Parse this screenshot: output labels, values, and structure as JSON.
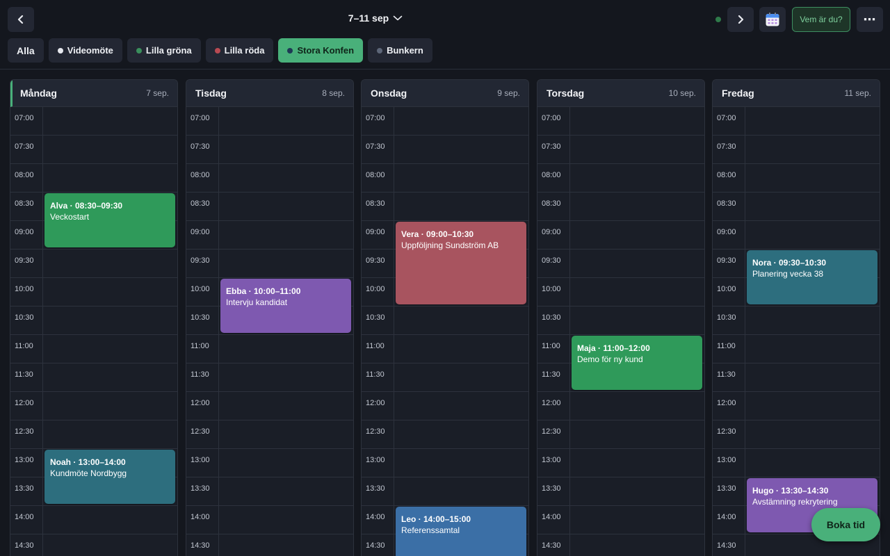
{
  "header": {
    "week_label": "7–11 sep",
    "who_button": "Vem är du?",
    "prev_icon": "chevron-left-icon",
    "next_icon": "chevron-right-icon",
    "more_label": "⋯"
  },
  "filters": [
    {
      "label": "Alla",
      "dot": null,
      "active": false
    },
    {
      "label": "Videomöte",
      "dot": "#e6e8ee",
      "active": false
    },
    {
      "label": "Lilla gröna",
      "dot": "#3a8f5c",
      "active": false
    },
    {
      "label": "Lilla röda",
      "dot": "#b84a52",
      "active": false
    },
    {
      "label": "Stora Konfen",
      "dot": "#1e3a55",
      "active": true
    },
    {
      "label": "Bunkern",
      "dot": "#5d6678",
      "active": false
    }
  ],
  "times": [
    "07:00",
    "07:30",
    "08:00",
    "08:30",
    "09:00",
    "09:30",
    "10:00",
    "10:30",
    "11:00",
    "11:30",
    "12:00",
    "12:30",
    "13:00",
    "13:30",
    "14:00",
    "14:30"
  ],
  "days": [
    {
      "name": "Måndag",
      "date": "7 sep.",
      "today": true,
      "events": [
        {
          "title": "Alva · 08:30–09:30",
          "desc": "Veckostart",
          "start": "08:30",
          "end": "09:30",
          "color": "#2f9a5a"
        },
        {
          "title": "Noah · 13:00–14:00",
          "desc": "Kundmöte Nordbygg",
          "start": "13:00",
          "end": "14:00",
          "color": "#2d6e7e"
        }
      ]
    },
    {
      "name": "Tisdag",
      "date": "8 sep.",
      "today": false,
      "events": [
        {
          "title": "Ebba · 10:00–11:00",
          "desc": "Intervju kandidat",
          "start": "10:00",
          "end": "11:00",
          "color": "#7e59b0"
        }
      ]
    },
    {
      "name": "Onsdag",
      "date": "9 sep.",
      "today": false,
      "events": [
        {
          "title": "Vera · 09:00–10:30",
          "desc": "Uppföljning Sundström AB",
          "start": "09:00",
          "end": "10:30",
          "color": "#a8545f"
        },
        {
          "title": "Leo · 14:00–15:00",
          "desc": "Referenssamtal",
          "start": "14:00",
          "end": "15:00",
          "color": "#3b6fa6"
        }
      ]
    },
    {
      "name": "Torsdag",
      "date": "10 sep.",
      "today": false,
      "events": [
        {
          "title": "Maja · 11:00–12:00",
          "desc": "Demo för ny kund",
          "start": "11:00",
          "end": "12:00",
          "color": "#2f9a5a"
        }
      ]
    },
    {
      "name": "Fredag",
      "date": "11 sep.",
      "today": false,
      "events": [
        {
          "title": "Nora · 09:30–10:30",
          "desc": "Planering vecka 38",
          "start": "09:30",
          "end": "10:30",
          "color": "#2d6e7e"
        },
        {
          "title": "Hugo · 13:30–14:30",
          "desc": "Avstämning rekrytering",
          "start": "13:30",
          "end": "14:30",
          "color": "#7e59b0"
        }
      ]
    }
  ],
  "fab": {
    "label": "Boka tid"
  }
}
